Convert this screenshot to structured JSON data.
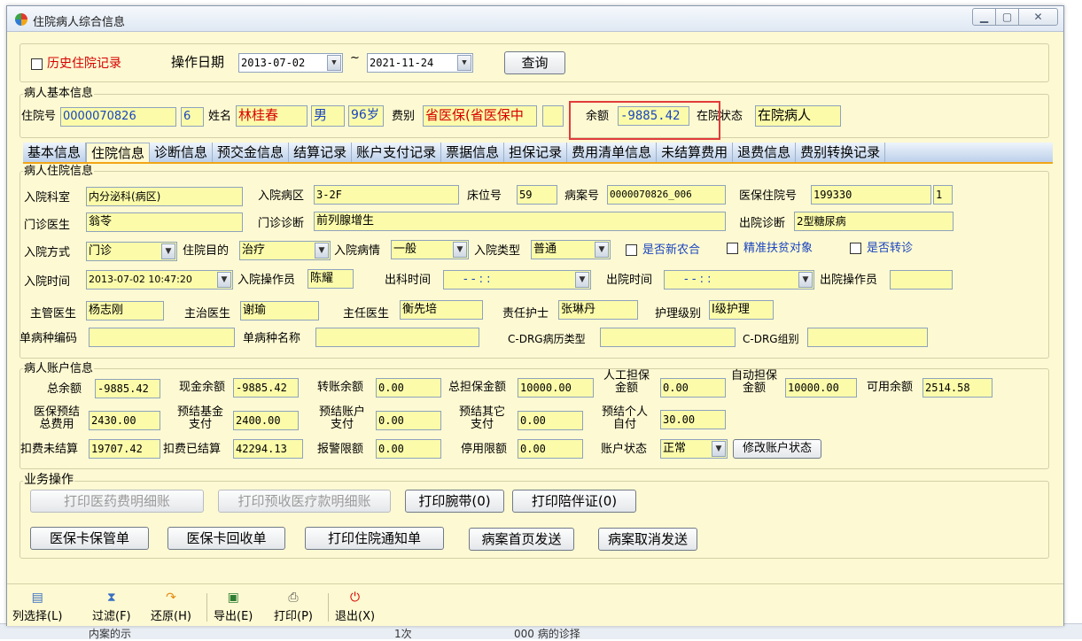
{
  "window": {
    "title": "住院病人综合信息"
  },
  "filter": {
    "history_label": "历史住院记录",
    "date_label": "操作日期",
    "date_from": "2013-07-02",
    "date_sep": "~",
    "date_to": "2021-11-24",
    "query_button": "查询"
  },
  "basic": {
    "group_title": "病人基本信息",
    "inpatient_no_label": "住院号",
    "inpatient_no": "0000070826",
    "visit_count": "6",
    "name_label": "姓名",
    "name": "林桂春",
    "gender": "男",
    "age": "96岁",
    "fee_type_label": "费别",
    "fee_type": "省医保(省医保中",
    "balance_label": "余额",
    "balance": "-9885.42",
    "status_label": "在院状态",
    "status": "在院病人"
  },
  "tabs": [
    "基本信息",
    "住院信息",
    "诊断信息",
    "预交金信息",
    "结算记录",
    "账户支付记录",
    "票据信息",
    "担保记录",
    "费用清单信息",
    "未结算费用",
    "退费信息",
    "费别转换记录"
  ],
  "inpatient": {
    "group_title": "病人住院信息",
    "dept_label": "入院科室",
    "dept": "内分泌科(病区)",
    "ward_label": "入院病区",
    "ward": "3-2F",
    "bed_label": "床位号",
    "bed": "59",
    "case_no_label": "病案号",
    "case_no": "0000070826_006",
    "ins_no_label": "医保住院号",
    "ins_no": "199330",
    "ins_seq": "1",
    "op_doctor_label": "门诊医生",
    "op_doctor": "翁苓",
    "op_diag_label": "门诊诊断",
    "op_diag": "前列腺增生",
    "out_diag_label": "出院诊断",
    "out_diag": "2型糖尿病",
    "adm_way_label": "入院方式",
    "adm_way": "门诊",
    "purpose_label": "住院目的",
    "purpose": "治疗",
    "condition_label": "入院病情",
    "condition": "一般",
    "adm_type_label": "入院类型",
    "adm_type": "普通",
    "nrcms_label": "是否新农合",
    "poverty_label": "精准扶贫对象",
    "transfer_label": "是否转诊",
    "adm_time_label": "入院时间",
    "adm_time": "2013-07-02 10:47:20",
    "adm_operator_label": "入院操作员",
    "adm_operator": "陈耀",
    "leave_dept_label": "出科时间",
    "leave_dept_time": "- -   : :",
    "discharge_label": "出院时间",
    "discharge_time": "- -   : :",
    "dis_operator_label": "出院操作员",
    "chief_label": "主管医生",
    "chief": "杨志刚",
    "attending_label": "主治医生",
    "attending": "谢瑜",
    "director_label": "主任医生",
    "director": "衡先培",
    "nurse_label": "责任护士",
    "nurse": "张琳丹",
    "care_label": "护理级别",
    "care": "I级护理",
    "disease_code_label": "单病种编码",
    "disease_name_label": "单病种名称",
    "drg_type_label": "C-DRG病历类型",
    "drg_group_label": "C-DRG组别"
  },
  "account": {
    "group_title": "病人账户信息",
    "total_balance_label": "总余额",
    "total_balance": "-9885.42",
    "cash_balance_label": "现金余额",
    "cash_balance": "-9885.42",
    "transfer_balance_label": "转账余额",
    "transfer_balance": "0.00",
    "total_guarantee_label": "总担保金额",
    "total_guarantee": "10000.00",
    "manual_guarantee_label1": "人工担保",
    "manual_guarantee_label2": "金额",
    "manual_guarantee": "0.00",
    "auto_guarantee_label1": "自动担保",
    "auto_guarantee_label2": "金额",
    "auto_guarantee": "10000.00",
    "available_label": "可用余额",
    "available": "2514.58",
    "ins_total_label1": "医保预结",
    "ins_total_label2": "总费用",
    "ins_total": "2430.00",
    "fund_label1": "预结基金",
    "fund_label2": "支付",
    "fund": "2400.00",
    "acct_pay_label1": "预结账户",
    "acct_pay_label2": "支付",
    "acct_pay": "0.00",
    "other_pay_label1": "预结其它",
    "other_pay_label2": "支付",
    "other_pay": "0.00",
    "self_pay_label1": "预结个人",
    "self_pay_label2": "自付",
    "self_pay": "30.00",
    "unsettled_label": "扣费未结算",
    "unsettled": "19707.42",
    "settled_label": "扣费已结算",
    "settled": "42294.13",
    "alarm_label": "报警限额",
    "alarm": "0.00",
    "stop_label": "停用限额",
    "stop": "0.00",
    "acct_status_label": "账户状态",
    "acct_status": "正常",
    "modify_button": "修改账户状态"
  },
  "ops": {
    "group_title": "业务操作",
    "print_drug_detail": "打印医药费明细账",
    "print_prepaid_detail": "打印预收医疗款明细账",
    "print_wristband": "打印腕带(0)",
    "print_companion": "打印陪伴证(0)",
    "card_keep": "医保卡保管单",
    "card_return": "医保卡回收单",
    "print_notice": "打印住院通知单",
    "send_homepage": "病案首页发送",
    "cancel_send": "病案取消发送"
  },
  "toolbar": {
    "columns": "列选择(L)",
    "filter": "过滤(F)",
    "restore": "还原(H)",
    "export": "导出(E)",
    "print": "打印(P)",
    "exit": "退出(X)"
  },
  "background": {
    "item1": "内案的示",
    "item2": "1次",
    "item3": "000 病的诊择"
  }
}
